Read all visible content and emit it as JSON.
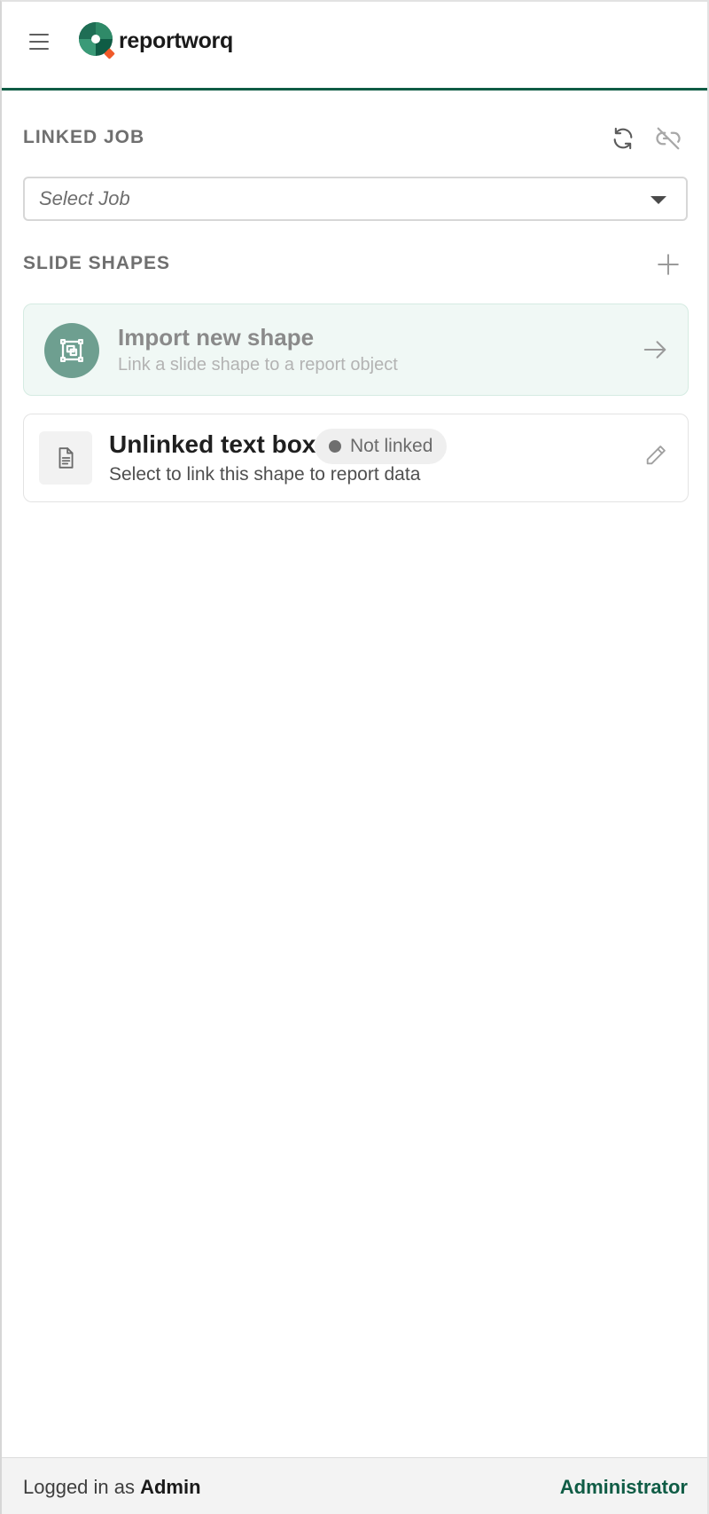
{
  "app": {
    "brand": "reportworq",
    "colors": {
      "accent": "#0f5c45",
      "logo_secondary": "#f05a2a"
    },
    "icons": {
      "menu": "hamburger-icon"
    }
  },
  "linked_job": {
    "title": "LINKED JOB",
    "select_placeholder": "Select Job",
    "icons": [
      "refresh-icon",
      "unlink-icon",
      "chevron-down-icon"
    ]
  },
  "slide_shapes": {
    "title": "SLIDE SHAPES",
    "add_icon": "plus-icon",
    "import_card": {
      "title": "Import new shape",
      "subtitle": "Link a slide shape to a report object",
      "icon": "shape-select-icon"
    },
    "items": [
      {
        "title": "Unlinked text box",
        "status": "Not linked",
        "subtitle": "Select to link this shape to report data",
        "icon": "document-icon"
      }
    ]
  },
  "footer": {
    "login_prefix": "Logged in as ",
    "user": "Admin",
    "role": "Administrator"
  }
}
